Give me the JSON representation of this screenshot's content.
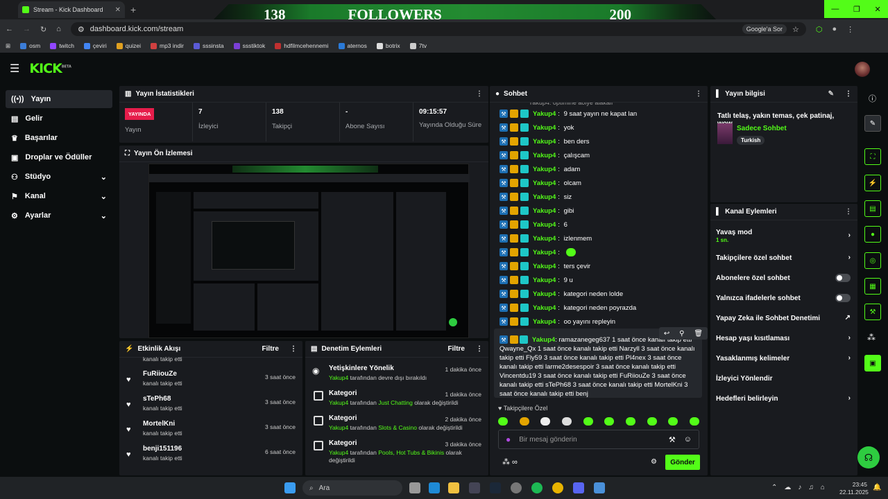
{
  "browser": {
    "tab_title": "Stream - Kick Dashboard",
    "url": "dashboard.kick.com/stream",
    "google_label": "Google'a Sor",
    "bookmarks": [
      "osm",
      "twitch",
      "çeviri",
      "quizei",
      "mp3 indir",
      "sssinsta",
      "ssstiktok",
      "hdfilmcehennemi",
      "aternos",
      "botrix",
      "7tv"
    ]
  },
  "overlay": {
    "left_count": "138",
    "label": "FOLLOWERS",
    "right_count": "200"
  },
  "kick": {
    "logo": "KICK",
    "beta": "BETA"
  },
  "sidebar": {
    "items": [
      {
        "label": "Yayın",
        "icon": "broadcast-icon"
      },
      {
        "label": "Gelir",
        "icon": "revenue-icon"
      },
      {
        "label": "Başarılar",
        "icon": "trophy-icon"
      },
      {
        "label": "Droplar ve Ödüller",
        "icon": "gift-icon"
      },
      {
        "label": "Stüdyo",
        "icon": "studio-icon"
      },
      {
        "label": "Kanal",
        "icon": "channel-icon"
      },
      {
        "label": "Ayarlar",
        "icon": "gear-icon"
      }
    ]
  },
  "stats": {
    "title": "Yayın İstatistikleri",
    "status_badge": "YAYINDA",
    "status_label": "Yayın",
    "viewers_value": "7",
    "viewers_label": "İzleyici",
    "followers_value": "138",
    "followers_label": "Takipçi",
    "subs_value": "-",
    "subs_label": "Abone Sayısı",
    "uptime_value": "09:15:57",
    "uptime_label": "Yayında Olduğu Süre"
  },
  "preview": {
    "title": "Yayın Ön İzlemesi"
  },
  "activity": {
    "title": "Etkinlik Akışı",
    "filter": "Filtre",
    "rows": [
      {
        "name": "FuRiiouZe",
        "sub": "kanalı takip etti",
        "time": "3 saat önce"
      },
      {
        "name": "sTePh68",
        "sub": "kanalı takip etti",
        "time": "3 saat önce"
      },
      {
        "name": "MortelKni",
        "sub": "kanalı takip etti",
        "time": "3 saat önce"
      },
      {
        "name": "benji151196",
        "sub": "kanalı takip etti",
        "time": "6 saat önce"
      }
    ],
    "partial_sub": "kanalı takip etti"
  },
  "moderation": {
    "title": "Denetim Eylemleri",
    "filter": "Filtre",
    "rows": [
      {
        "title": "Yetişkinlere Yönelik",
        "user": "Yakup4",
        "text": " tarafından devre dışı bırakıldı",
        "hl": "",
        "tail": "",
        "time": "1 dakika önce"
      },
      {
        "title": "Kategori",
        "user": "Yakup4",
        "text": " tarafından ",
        "hl": "Just Chatting",
        "tail": " olarak değiştirildi",
        "time": "1 dakika önce"
      },
      {
        "title": "Kategori",
        "user": "Yakup4",
        "text": " tarafından ",
        "hl": "Slots & Casino",
        "tail": " olarak değiştirildi",
        "time": "2 dakika önce"
      },
      {
        "title": "Kategori",
        "user": "Yakup4",
        "text": " tarafından ",
        "hl": "Pools, Hot Tubs & Bikinis",
        "tail": " olarak değiştirildi",
        "time": "3 dakika önce"
      }
    ]
  },
  "chat": {
    "title": "Sohbet",
    "top_partial": "Yakup4: optimine aöiye alakalı",
    "messages": [
      {
        "user": "Yakup4",
        "text": "9 saat yayın ne kapat lan"
      },
      {
        "user": "Yakup4",
        "text": "yok"
      },
      {
        "user": "Yakup4",
        "text": "ben ders"
      },
      {
        "user": "Yakup4",
        "text": "çalışcam"
      },
      {
        "user": "Yakup4",
        "text": "adam"
      },
      {
        "user": "Yakup4",
        "text": "olcam"
      },
      {
        "user": "Yakup4",
        "text": "siz"
      },
      {
        "user": "Yakup4",
        "text": "gibi"
      },
      {
        "user": "Yakup4",
        "text": "6"
      },
      {
        "user": "Yakup4",
        "text": "izlenmem"
      },
      {
        "user": "Yakup4",
        "text": ""
      },
      {
        "user": "Yakup4",
        "text": "ters çevir"
      },
      {
        "user": "Yakup4",
        "text": "9 u"
      },
      {
        "user": "Yakup4",
        "text": "kategori neden lolde"
      },
      {
        "user": "Yakup4",
        "text": "kategori neden poyrazda"
      },
      {
        "user": "Yakup4",
        "text": "oo yayını repleyin"
      }
    ],
    "long_user": "Yakup4",
    "long_text": "ramazanegeg637 1 saat önce kanalı takip etti Qwayne_Qx 1 saat önce kanalı takip etti Narzyll 3 saat önce kanalı takip etti Fly59 3 saat önce kanalı takip etti Pl4nex 3 saat önce kanalı takip etti larme2desespoir 3 saat önce kanalı takip etti Vincentdu19 3 saat önce kanalı takip etti FuRiiouZe 3 saat önce kanalı takip etti sTePh68 3 saat önce kanalı takip etti MortelKni 3 saat önce kanalı takip etti benj",
    "mode_label": "Takipçilere Özel",
    "input_placeholder": "Bir mesaj gönderin",
    "send_label": "Gönder"
  },
  "stream_info": {
    "title": "Yayın bilgisi",
    "stream_title": "Tatlı telaş, yakın temas, çek patinaj, wow",
    "category": "Sadece Sohbet",
    "language": "Turkish"
  },
  "channel_actions": {
    "title": "Kanal Eylemleri",
    "slow_mode": "Yavaş mod",
    "slow_value": "1 sn.",
    "items": [
      {
        "label": "Takipçilere özel sohbet",
        "control": "chevron"
      },
      {
        "label": "Abonelere özel sohbet",
        "control": "toggle"
      },
      {
        "label": "Yalnızca ifadelerle sohbet",
        "control": "toggle"
      },
      {
        "label": "Yapay Zeka ile Sohbet Denetimi",
        "control": "external"
      },
      {
        "label": "Hesap yaşı kısıtlaması",
        "control": "chevron"
      },
      {
        "label": "Yasaklanmış kelimeler",
        "control": "chevron"
      },
      {
        "label": "İzleyici Yönlendir",
        "control": "none"
      },
      {
        "label": "Hedefleri belirleyin",
        "control": "chevron"
      }
    ]
  },
  "taskbar": {
    "search": "Ara",
    "time": "23:45",
    "date": "22.11.2025"
  },
  "colors": {
    "accent": "#53fc18",
    "live": "#e61d4b",
    "panel": "#191b1f",
    "bg": "#0b0e0f"
  }
}
